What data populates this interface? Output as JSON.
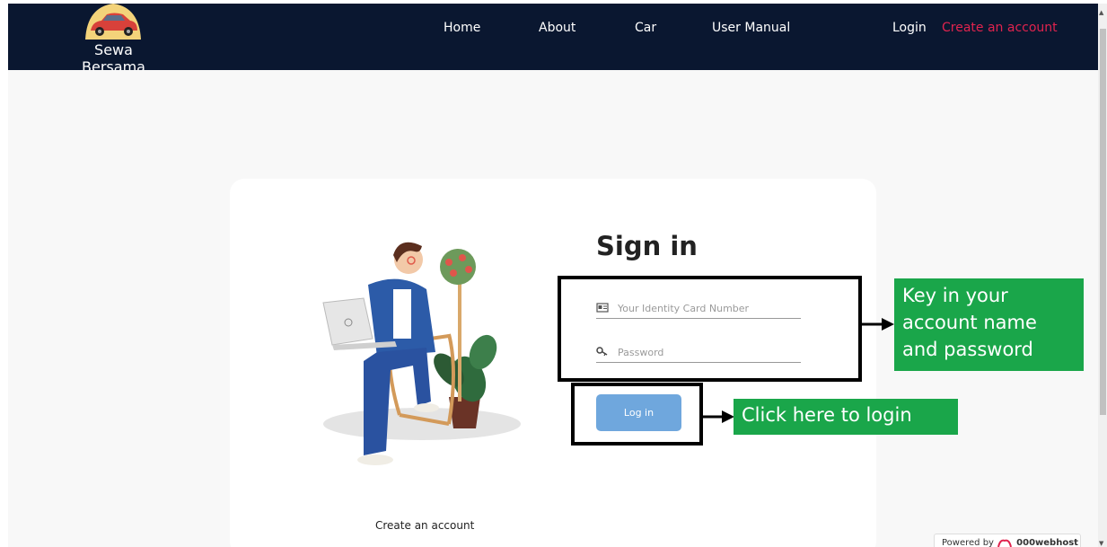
{
  "brand": {
    "name": "Sewa Bersama",
    "logo_icon": "car-logo-icon"
  },
  "nav": {
    "items": [
      {
        "label": "Home"
      },
      {
        "label": "About"
      },
      {
        "label": "Car"
      },
      {
        "label": "User Manual"
      }
    ],
    "login": "Login",
    "create_account": "Create an account",
    "accent_color": "#e0234e"
  },
  "signin": {
    "title": "Sign in",
    "id_placeholder": "Your Identity Card Number",
    "password_placeholder": "Password",
    "login_button": "Log in",
    "create_account_link": "Create an account"
  },
  "annotations": {
    "credentials_note": "Key in your account name and password",
    "login_note": "Click here to login",
    "label_color": "#1aa64a"
  },
  "footer": {
    "powered_by": "Powered by",
    "host_name": "000webhost"
  }
}
